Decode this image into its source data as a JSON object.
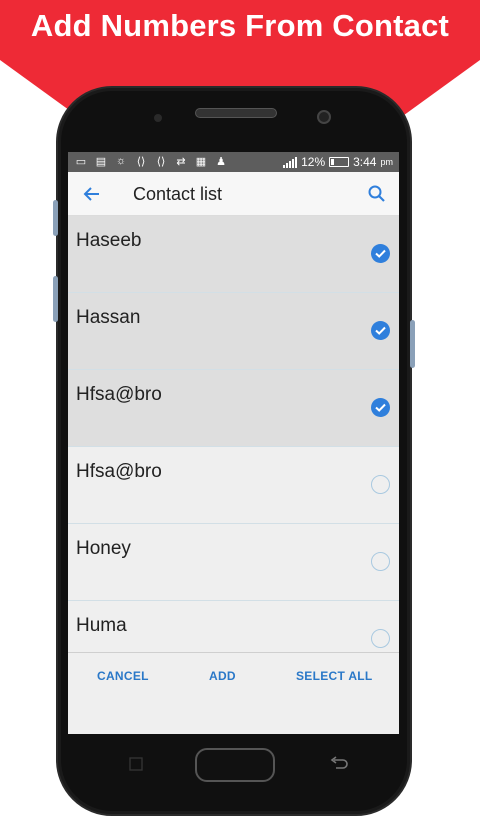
{
  "banner": {
    "title": "Add Numbers From Contact",
    "color": "#ee2a36"
  },
  "statusbar": {
    "battery": "12%",
    "time": "3:44",
    "ampm": "pm",
    "icons": [
      "screen-mirror-icon",
      "chat-icon",
      "brightness-icon",
      "code-icon",
      "code-icon",
      "sync-icon",
      "contact-card-icon",
      "android-icon"
    ]
  },
  "appbar": {
    "title": "Contact list"
  },
  "contacts": [
    {
      "name": "Haseeb",
      "checked": true
    },
    {
      "name": "Hassan",
      "checked": true
    },
    {
      "name": "Hfsa@bro",
      "checked": true
    },
    {
      "name": "Hfsa@bro",
      "checked": false
    },
    {
      "name": "Honey",
      "checked": false
    },
    {
      "name": "Huma",
      "checked": false
    }
  ],
  "actions": {
    "cancel": "CANCEL",
    "add": "ADD",
    "select_all": "SELECT ALL"
  },
  "colors": {
    "accent": "#2f7fdc",
    "checked_row": "#dedede",
    "unchecked_row": "#efefef"
  }
}
